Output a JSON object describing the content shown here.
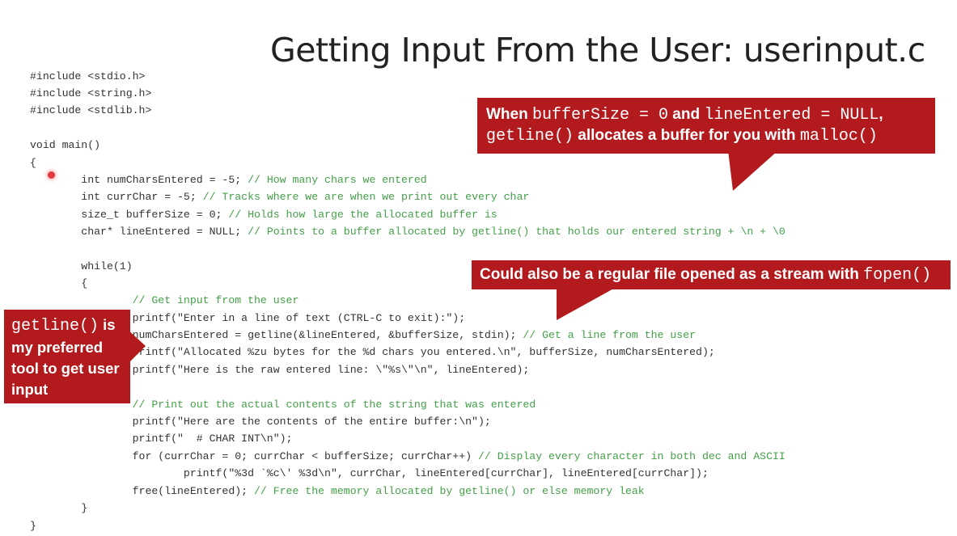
{
  "title": "Getting Input From the User: userinput.c",
  "code_lines": [
    {
      "code": "#include <stdio.h>",
      "comment": ""
    },
    {
      "code": "#include <string.h>",
      "comment": ""
    },
    {
      "code": "#include <stdlib.h>",
      "comment": ""
    },
    {
      "code": "",
      "comment": ""
    },
    {
      "code": "void main()",
      "comment": ""
    },
    {
      "code": "{",
      "comment": ""
    },
    {
      "code": "        int numCharsEntered = -5; ",
      "comment": "// How many chars we entered"
    },
    {
      "code": "        int currChar = -5; ",
      "comment": "// Tracks where we are when we print out every char"
    },
    {
      "code": "        size_t bufferSize = 0; ",
      "comment": "// Holds how large the allocated buffer is"
    },
    {
      "code": "        char* lineEntered = NULL; ",
      "comment": "// Points to a buffer allocated by getline() that holds our entered string + \\n + \\0"
    },
    {
      "code": "",
      "comment": ""
    },
    {
      "code": "        while(1)",
      "comment": ""
    },
    {
      "code": "        {",
      "comment": ""
    },
    {
      "code": "                ",
      "comment": "// Get input from the user"
    },
    {
      "code": "                printf(\"Enter in a line of text (CTRL-C to exit):\");",
      "comment": ""
    },
    {
      "code": "                numCharsEntered = getline(&lineEntered, &bufferSize, stdin); ",
      "comment": "// Get a line from the user"
    },
    {
      "code": "                printf(\"Allocated %zu bytes for the %d chars you entered.\\n\", bufferSize, numCharsEntered);",
      "comment": ""
    },
    {
      "code": "                printf(\"Here is the raw entered line: \\\"%s\\\"\\n\", lineEntered);",
      "comment": ""
    },
    {
      "code": "",
      "comment": ""
    },
    {
      "code": "                ",
      "comment": "// Print out the actual contents of the string that was entered"
    },
    {
      "code": "                printf(\"Here are the contents of the entire buffer:\\n\");",
      "comment": ""
    },
    {
      "code": "                printf(\"  # CHAR INT\\n\");",
      "comment": ""
    },
    {
      "code": "                for (currChar = 0; currChar < bufferSize; currChar++) ",
      "comment": "// Display every character in both dec and ASCII"
    },
    {
      "code": "                        printf(\"%3d `%c\\' %3d\\n\", currChar, lineEntered[currChar], lineEntered[currChar]);",
      "comment": ""
    },
    {
      "code": "                free(lineEntered); ",
      "comment": "// Free the memory allocated by getline() or else memory leak"
    },
    {
      "code": "        }",
      "comment": ""
    },
    {
      "code": "}",
      "comment": ""
    }
  ],
  "callouts": {
    "malloc": {
      "t1": "When ",
      "m1": "bufferSize = 0",
      "t2": " and ",
      "m2": "lineEntered = NULL",
      "t3": ",",
      "m3": "getline()",
      "t4": " allocates a buffer for you with ",
      "m4": "malloc()"
    },
    "fopen": {
      "t1": "Could also be a regular file opened as a stream with ",
      "m1": "fopen()"
    },
    "getline": {
      "m1": "getline()",
      "t1": " is",
      "t2": "my preferred",
      "t3": "tool to get user",
      "t4": "input"
    }
  },
  "colors": {
    "callout_bg": "#b21a1e",
    "comment": "#43a047",
    "code_text": "#333333"
  }
}
